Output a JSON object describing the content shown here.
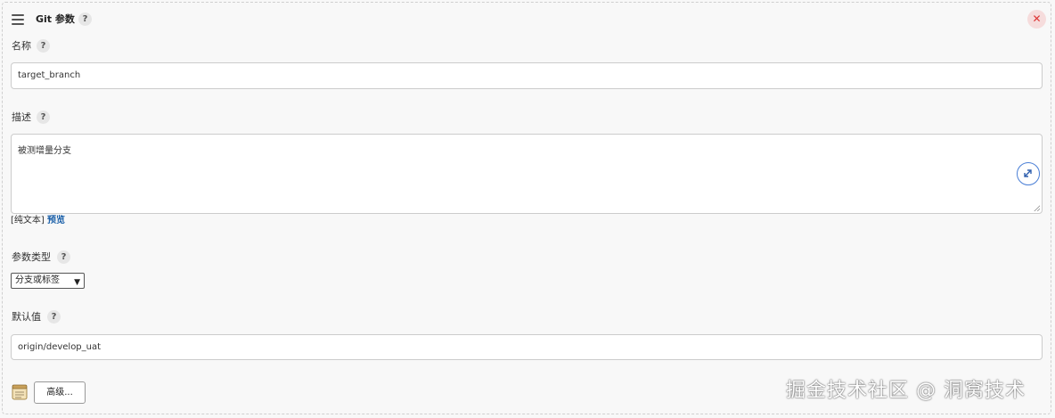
{
  "panel": {
    "title": "Git 参数",
    "help": "?",
    "close_glyph": "✕"
  },
  "name_field": {
    "label": "名称",
    "value": "target_branch"
  },
  "description_field": {
    "label": "描述",
    "value": "被测增量分支",
    "plain_text_link": "[纯文本]",
    "preview_link": "预览"
  },
  "param_type": {
    "label": "参数类型",
    "selected": "分支或标签"
  },
  "default_value": {
    "label": "默认值",
    "value": "origin/develop_uat"
  },
  "advanced_button": "高级...",
  "watermark": "掘金技术社区 @ 洞窝技术",
  "colors": {
    "accent": "#1a5fa8",
    "close_bg": "#f6dcdc",
    "close_fg": "#dd3333",
    "expand_border": "#4a7fd6"
  }
}
